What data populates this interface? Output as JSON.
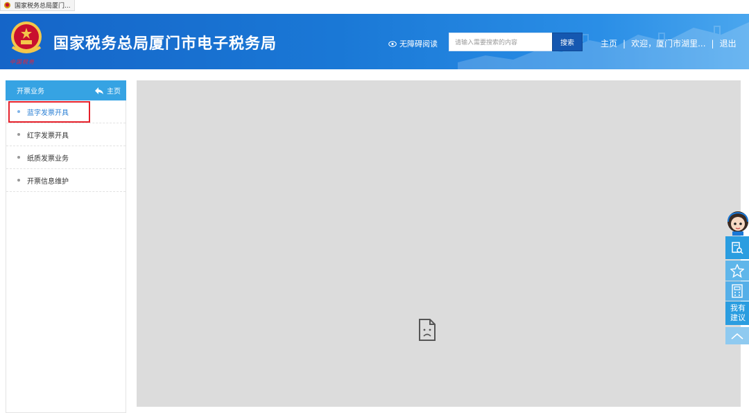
{
  "browser": {
    "tab_title": "国家税务总局厦门..."
  },
  "header": {
    "site_title": "国家税务总局厦门市电子税务局",
    "motto": "中国税务",
    "accessibility_label": "无障碍阅读",
    "search": {
      "placeholder": "请输入需要搜索的内容",
      "button_label": "搜索"
    },
    "nav": {
      "home": "主页",
      "welcome": "欢迎，厦门市湖里...",
      "logout": "退出",
      "separator": "|"
    }
  },
  "sidebar": {
    "title": "开票业务",
    "home_label": "主页",
    "items": [
      {
        "label": "蓝字发票开具",
        "active": true
      },
      {
        "label": "红字发票开具",
        "active": false
      },
      {
        "label": "纸质发票业务",
        "active": false
      },
      {
        "label": "开票信息维护",
        "active": false
      }
    ]
  },
  "floating_toolbar": {
    "suggest_line1": "我有",
    "suggest_line2": "建议",
    "icons": [
      "service-avatar-icon",
      "search-doc-icon",
      "star-icon",
      "calculator-icon",
      "chevron-up-icon"
    ]
  },
  "colors": {
    "header_blue": "#1a78d6",
    "sidebar_header": "#36a3e3",
    "active_item": "#2a7fd4",
    "highlight_box": "#e5202a",
    "main_bg": "#dcdcdc"
  }
}
